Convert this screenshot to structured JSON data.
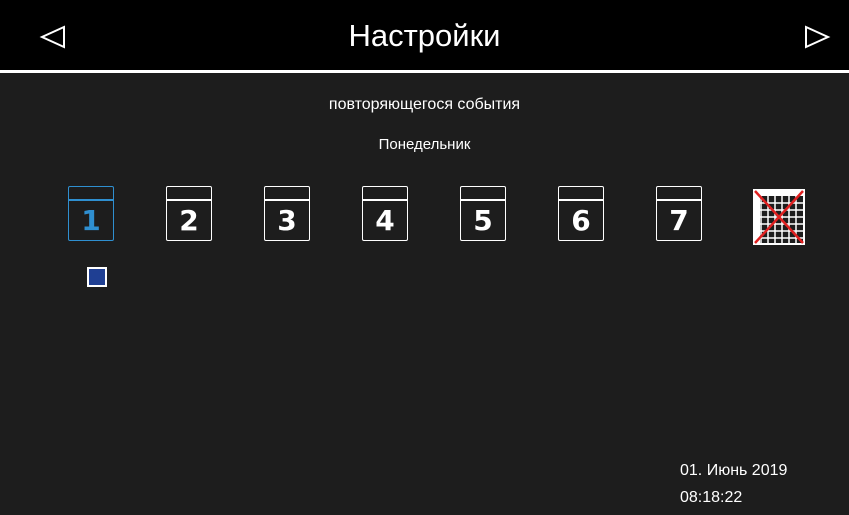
{
  "header": {
    "title": "Настройки",
    "prev_icon": "triangle-left-icon",
    "next_icon": "triangle-right-icon"
  },
  "event": {
    "subtitle": "повторяющегося события",
    "selected_day_name": "Понедельник"
  },
  "days": [
    {
      "label": "1",
      "selected": true
    },
    {
      "label": "2",
      "selected": false
    },
    {
      "label": "3",
      "selected": false
    },
    {
      "label": "4",
      "selected": false
    },
    {
      "label": "5",
      "selected": false
    },
    {
      "label": "6",
      "selected": false
    },
    {
      "label": "7",
      "selected": false
    }
  ],
  "extra_icon": "calendar-grid-crossed-icon",
  "checkbox": {
    "checked": true
  },
  "footer": {
    "date": "01. Июнь 2019",
    "time": "08:18:22"
  },
  "colors": {
    "background": "#1d1d1d",
    "header": "#000000",
    "accent": "#2f8fd0",
    "checkbox_fill": "#1f3f93",
    "cross": "#e02020"
  }
}
